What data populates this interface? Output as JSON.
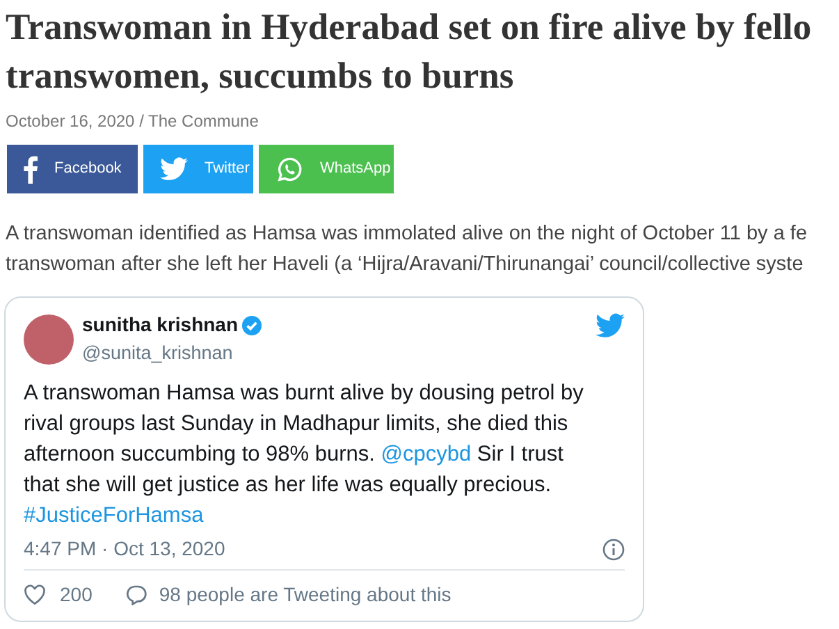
{
  "headline_lines": [
    "Transwoman in Hyderabad set on fire alive by fello",
    "transwomen, succumbs to burns"
  ],
  "byline": "October 16, 2020 / The Commune",
  "share_buttons": [
    {
      "kind": "facebook",
      "label": "Facebook"
    },
    {
      "kind": "twitter",
      "label": "Twitter"
    },
    {
      "kind": "whatsapp",
      "label": "WhatsApp"
    }
  ],
  "paragraph_lines": [
    "A transwoman identified as Hamsa was immolated alive on the night of October 11 by a fe",
    "transwoman after she left her Haveli (a ‘Hijra/Aravani/Thirunangai’ council/collective syste"
  ],
  "tweet": {
    "name": "sunitha krishnan",
    "verified": true,
    "handle": "@sunita_krishnan",
    "body": [
      {
        "kind": "text",
        "text": "A transwoman Hamsa was burnt alive by dousing petrol by rival groups last Sunday in Madhapur limits, she died this afternoon succumbing to 98% burns. "
      },
      {
        "kind": "link",
        "text": "@cpcybd"
      },
      {
        "kind": "text",
        "text": " Sir I trust that she will get justice as her life was equally precious. "
      },
      {
        "kind": "link",
        "text": "#JusticeForHamsa"
      }
    ],
    "timestamp": "4:47 PM · Oct 13, 2020",
    "likes": "200",
    "talk": "98 people are Tweeting about this"
  }
}
